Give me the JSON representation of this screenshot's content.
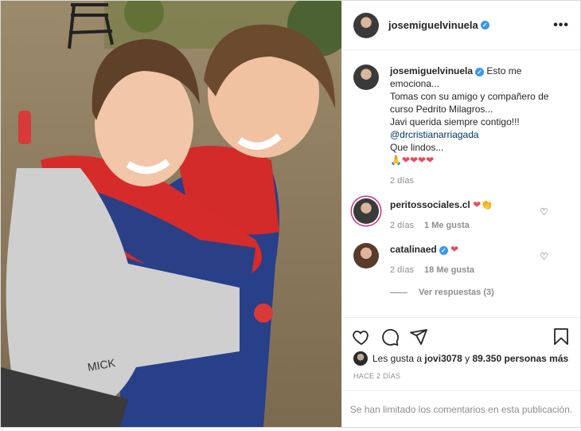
{
  "post": {
    "author": "josemiguelvinuela",
    "verified_mark": "✓",
    "more_label": "•••"
  },
  "caption": {
    "username": "josemiguelvinuela",
    "lines": [
      "Esto me emociona...",
      "Tomas con su amigo y compañero de curso Pedrito Milagros...",
      "Javi querida siempre contigo!!!"
    ],
    "mention": "@drcristianarriagada",
    "line_after": "Que lindos...",
    "emojis": "🙏❤❤❤❤",
    "age": "2 días"
  },
  "comments": [
    {
      "username": "peritossociales.cl",
      "text": "❤👏",
      "age": "2 días",
      "likes": "1 Me gusta"
    },
    {
      "username": "catalinaed",
      "text": "❤",
      "age": "2 días",
      "likes": "18 Me gusta",
      "verified": true,
      "replies_label": "Ver respuestas (3)"
    }
  ],
  "likes": {
    "prefix": "Les gusta a",
    "user": "jovi3078",
    "joiner": "y",
    "count": "89.350 personas más"
  },
  "timestamp": "Hace 2 días",
  "limited_notice": "Se han limitado los comentarios en esta publicación.",
  "colors": {
    "accent": "#3897f0",
    "heart": "#ed4956",
    "muted": "#8e8e8e"
  },
  "icons": [
    "heart-icon",
    "comment-icon",
    "share-icon",
    "bookmark-icon"
  ],
  "media": {
    "description_alt": "photo"
  }
}
